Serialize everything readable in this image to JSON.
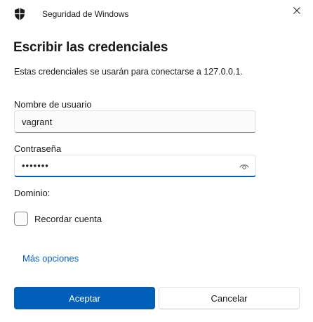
{
  "window": {
    "app_title": "Seguridad de Windows",
    "close_icon": "close-icon",
    "app_icon": "shield-icon"
  },
  "dialog": {
    "heading": "Escribir las credenciales",
    "subtitle": "Estas credenciales se usarán para conectarse a 127.0.0.1."
  },
  "form": {
    "username_label": "Nombre de usuario",
    "username_value": "vagrant",
    "password_label": "Contraseña",
    "password_value": "•••••••",
    "reveal_icon": "eye-icon",
    "domain_label": "Dominio:",
    "remember_label": "Recordar cuenta",
    "remember_checked": false
  },
  "links": {
    "more_options": "Más opciones"
  },
  "buttons": {
    "accept": "Aceptar",
    "cancel": "Cancelar"
  },
  "colors": {
    "accent": "#005fb8",
    "text": "#1a1a1a",
    "background": "#ffffff"
  }
}
